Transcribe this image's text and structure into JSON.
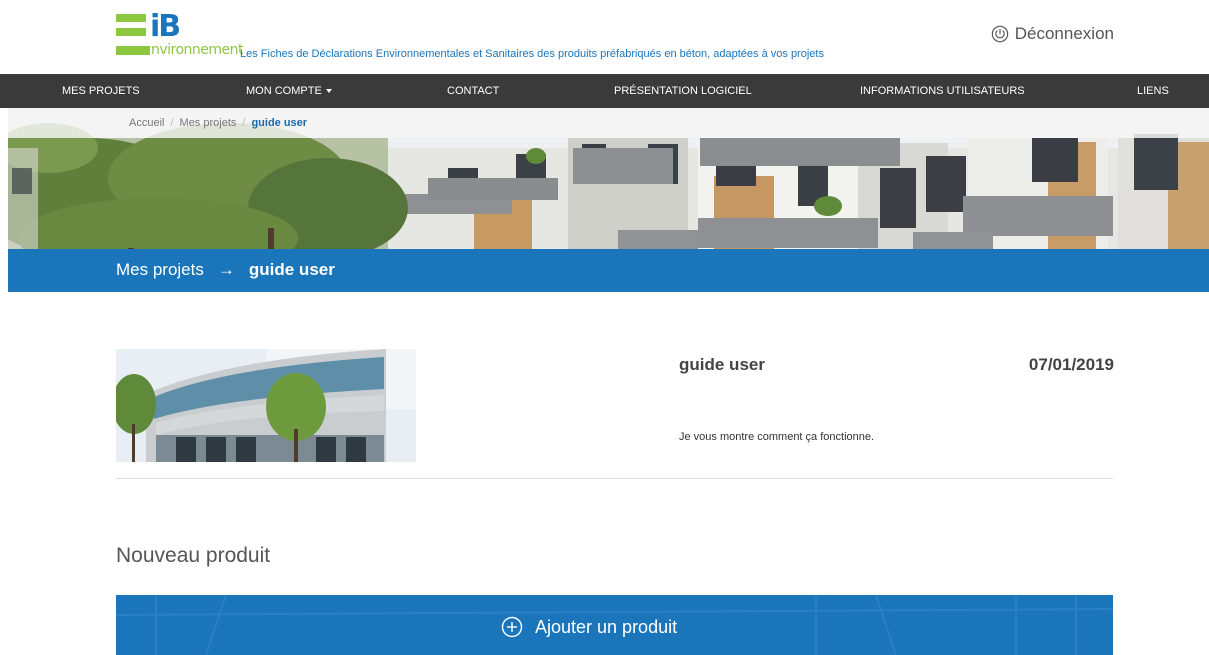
{
  "header": {
    "logo_text": "iB",
    "logo_word": "nvironnement",
    "tagline": "Les Fiches de Déclarations Environnementales et Sanitaires des produits préfabriqués en béton, adaptées à vos projets",
    "logout_label": "Déconnexion",
    "logout_icon": "power-icon"
  },
  "nav": {
    "items": [
      {
        "label": "MES PROJETS"
      },
      {
        "label": "MON COMPTE"
      },
      {
        "label": "CONTACT"
      },
      {
        "label": "PRÉSENTATION LOGICIEL"
      },
      {
        "label": "INFORMATIONS UTILISATEURS"
      },
      {
        "label": "LIENS"
      }
    ]
  },
  "breadcrumb": {
    "items": [
      "Accueil",
      "Mes projets",
      "guide user"
    ],
    "separator": "/"
  },
  "hero": {
    "parent": "Mes projets",
    "arrow": "→",
    "current": "guide user"
  },
  "project": {
    "name": "guide user",
    "date": "07/01/2019",
    "description": "Je vous montre comment ça fonctionne."
  },
  "new_product": {
    "title": "Nouveau produit",
    "add_label": "Ajouter un produit",
    "add_icon": "plus-circle-icon"
  },
  "colors": {
    "brand_blue": "#1a75bb",
    "brand_green": "#8dc63f",
    "nav_bg": "#3a3a3a"
  }
}
